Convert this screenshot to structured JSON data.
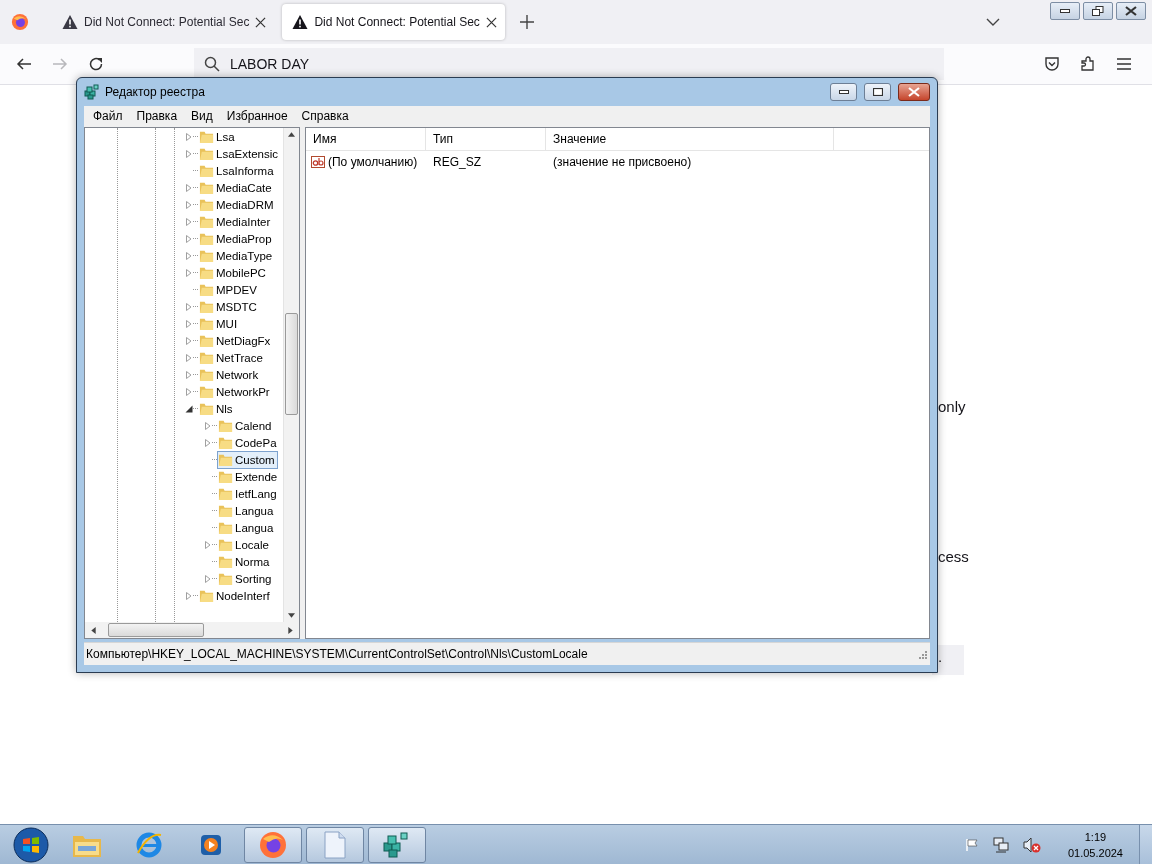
{
  "browser": {
    "tabs": [
      {
        "title": "Did Not Connect: Potential Sec",
        "selected": false
      },
      {
        "title": "Did Not Connect: Potential Sec",
        "selected": true
      }
    ],
    "address": {
      "value": "LABOR DAY"
    },
    "forward_disabled": true,
    "page_fragments": [
      "only",
      "cess",
      "."
    ]
  },
  "regedit": {
    "title": "Редактор реестра",
    "menu": [
      "Файл",
      "Правка",
      "Вид",
      "Избранное",
      "Справка"
    ],
    "tree": [
      {
        "label": "Lsa",
        "kind": "branch",
        "expanded": false,
        "selected": false
      },
      {
        "label": "LsaExtensic",
        "kind": "branch",
        "expanded": false,
        "selected": false
      },
      {
        "label": "LsaInforma",
        "kind": "leaf",
        "selected": false
      },
      {
        "label": "MediaCate",
        "kind": "branch",
        "expanded": false,
        "selected": false
      },
      {
        "label": "MediaDRM",
        "kind": "branch",
        "expanded": false,
        "selected": false
      },
      {
        "label": "MediaInter",
        "kind": "branch",
        "expanded": false,
        "selected": false
      },
      {
        "label": "MediaProp",
        "kind": "branch",
        "expanded": false,
        "selected": false
      },
      {
        "label": "MediaType",
        "kind": "branch",
        "expanded": false,
        "selected": false
      },
      {
        "label": "MobilePC",
        "kind": "branch",
        "expanded": false,
        "selected": false
      },
      {
        "label": "MPDEV",
        "kind": "leaf",
        "selected": false
      },
      {
        "label": "MSDTC",
        "kind": "branch",
        "expanded": false,
        "selected": false
      },
      {
        "label": "MUI",
        "kind": "branch",
        "expanded": false,
        "selected": false
      },
      {
        "label": "NetDiagFx",
        "kind": "branch",
        "expanded": false,
        "selected": false
      },
      {
        "label": "NetTrace",
        "kind": "branch",
        "expanded": false,
        "selected": false
      },
      {
        "label": "Network",
        "kind": "branch",
        "expanded": false,
        "selected": false
      },
      {
        "label": "NetworkPr",
        "kind": "branch",
        "expanded": false,
        "selected": false
      },
      {
        "label": "Nls",
        "kind": "branch",
        "expanded": true,
        "selected": false,
        "children": [
          {
            "label": "Calend",
            "kind": "branch",
            "expanded": false,
            "selected": false
          },
          {
            "label": "CodePa",
            "kind": "branch",
            "expanded": false,
            "selected": false
          },
          {
            "label": "Custom",
            "kind": "leaf",
            "selected": true
          },
          {
            "label": "Extende",
            "kind": "leaf",
            "selected": false
          },
          {
            "label": "IetfLang",
            "kind": "leaf",
            "selected": false
          },
          {
            "label": "Langua",
            "kind": "leaf",
            "selected": false
          },
          {
            "label": "Langua",
            "kind": "leaf",
            "selected": false
          },
          {
            "label": "Locale",
            "kind": "branch",
            "expanded": false,
            "selected": false
          },
          {
            "label": "Norma",
            "kind": "leaf",
            "selected": false
          },
          {
            "label": "Sorting",
            "kind": "branch",
            "expanded": false,
            "selected": false
          }
        ]
      },
      {
        "label": "NodeInterf",
        "kind": "branch",
        "expanded": false,
        "selected": false
      }
    ],
    "columns": [
      "Имя",
      "Тип",
      "Значение"
    ],
    "rows": [
      {
        "name": "(По умолчанию)",
        "type": "REG_SZ",
        "value": "(значение не присвоено)"
      }
    ],
    "status": "Компьютер\\HKEY_LOCAL_MACHINE\\SYSTEM\\CurrentControlSet\\Control\\Nls\\CustomLocale"
  },
  "taskbar": {
    "apps": [
      {
        "kind": "explorer",
        "running": false
      },
      {
        "kind": "ie",
        "running": false
      },
      {
        "kind": "media",
        "running": false
      },
      {
        "kind": "firefox",
        "running": true
      },
      {
        "kind": "notepad",
        "running": true
      },
      {
        "kind": "regedit",
        "running": true
      }
    ],
    "volume_muted": true,
    "time": "1:19",
    "date": "01.05.2024"
  }
}
